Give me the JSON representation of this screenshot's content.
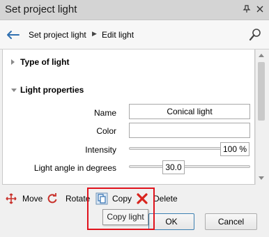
{
  "window": {
    "title": "Set project light",
    "pin_glyph": "⬦",
    "close_glyph": "✕"
  },
  "nav": {
    "breadcrumb": [
      "Set project light",
      "Edit light"
    ]
  },
  "sections": {
    "type_of_light": "Type of light",
    "light_properties": "Light properties"
  },
  "properties": {
    "name_label": "Name",
    "name_value": "Conical light",
    "color_label": "Color",
    "color_value": "",
    "intensity_label": "Intensity",
    "intensity_value": "100 %",
    "intensity_fraction": 1.0,
    "angle_label": "Light angle in degrees",
    "angle_value": "30.0",
    "angle_fraction": 0.3
  },
  "toolbar": {
    "move_label": "Move",
    "rotate_label": "Rotate",
    "copy_label": "Copy",
    "delete_label": "Delete"
  },
  "tooltip": {
    "text": "Copy light"
  },
  "buttons": {
    "ok_label": "OK",
    "cancel_label": "Cancel"
  },
  "colors": {
    "accent_blue": "#2f6fb0",
    "highlight_red": "#e0121c",
    "delete_red": "#d9241e"
  }
}
